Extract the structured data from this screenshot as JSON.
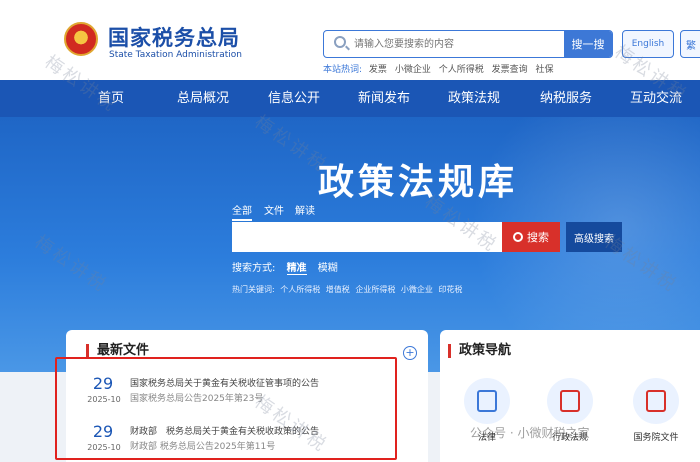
{
  "header": {
    "logo_cn": "国家税务总局",
    "logo_en": "State Taxation Administration",
    "search_placeholder": "请输入您要搜索的内容",
    "search_button": "搜一搜",
    "hot_label": "本站热词:",
    "hot_words": [
      "发票",
      "小微企业",
      "个人所得税",
      "发票查询",
      "社保"
    ],
    "lang_button": "English",
    "lang_button2": "繁"
  },
  "nav": {
    "items": [
      "首页",
      "总局概况",
      "信息公开",
      "新闻发布",
      "政策法规",
      "纳税服务",
      "互动交流"
    ]
  },
  "banner": {
    "title": "政策法规库",
    "scope_tabs": [
      "全部",
      "文件",
      "解读"
    ],
    "search_button": "搜索",
    "advanced_button": "高级搜索",
    "mode_label": "搜索方式:",
    "modes": [
      "精准",
      "模糊"
    ],
    "keywords_label": "热门关键词:",
    "keywords": [
      "个人所得税",
      "增值税",
      "企业所得税",
      "小微企业",
      "印花税"
    ]
  },
  "latest": {
    "title": "最新文件",
    "docs": [
      {
        "day": "29",
        "ym": "2025-10",
        "title": "国家税务总局关于黄金有关税收征管事项的公告",
        "sub": "国家税务总局公告2025年第23号"
      },
      {
        "day": "29",
        "ym": "2025-10",
        "title": "财政部　税务总局关于黄金有关税收政策的公告",
        "sub": "财政部 税务总局公告2025年第11号"
      }
    ]
  },
  "policy_nav": {
    "title": "政策导航",
    "items": [
      "法律",
      "行政法规",
      "国务院文件"
    ]
  },
  "overlay": {
    "watermark": "梅松讲税",
    "wechat_caption": "公众号 · 小微财税之家"
  },
  "colors": {
    "primary": "#1b56b5",
    "accent_red": "#d8302a",
    "highlight_box": "#e0221e"
  }
}
